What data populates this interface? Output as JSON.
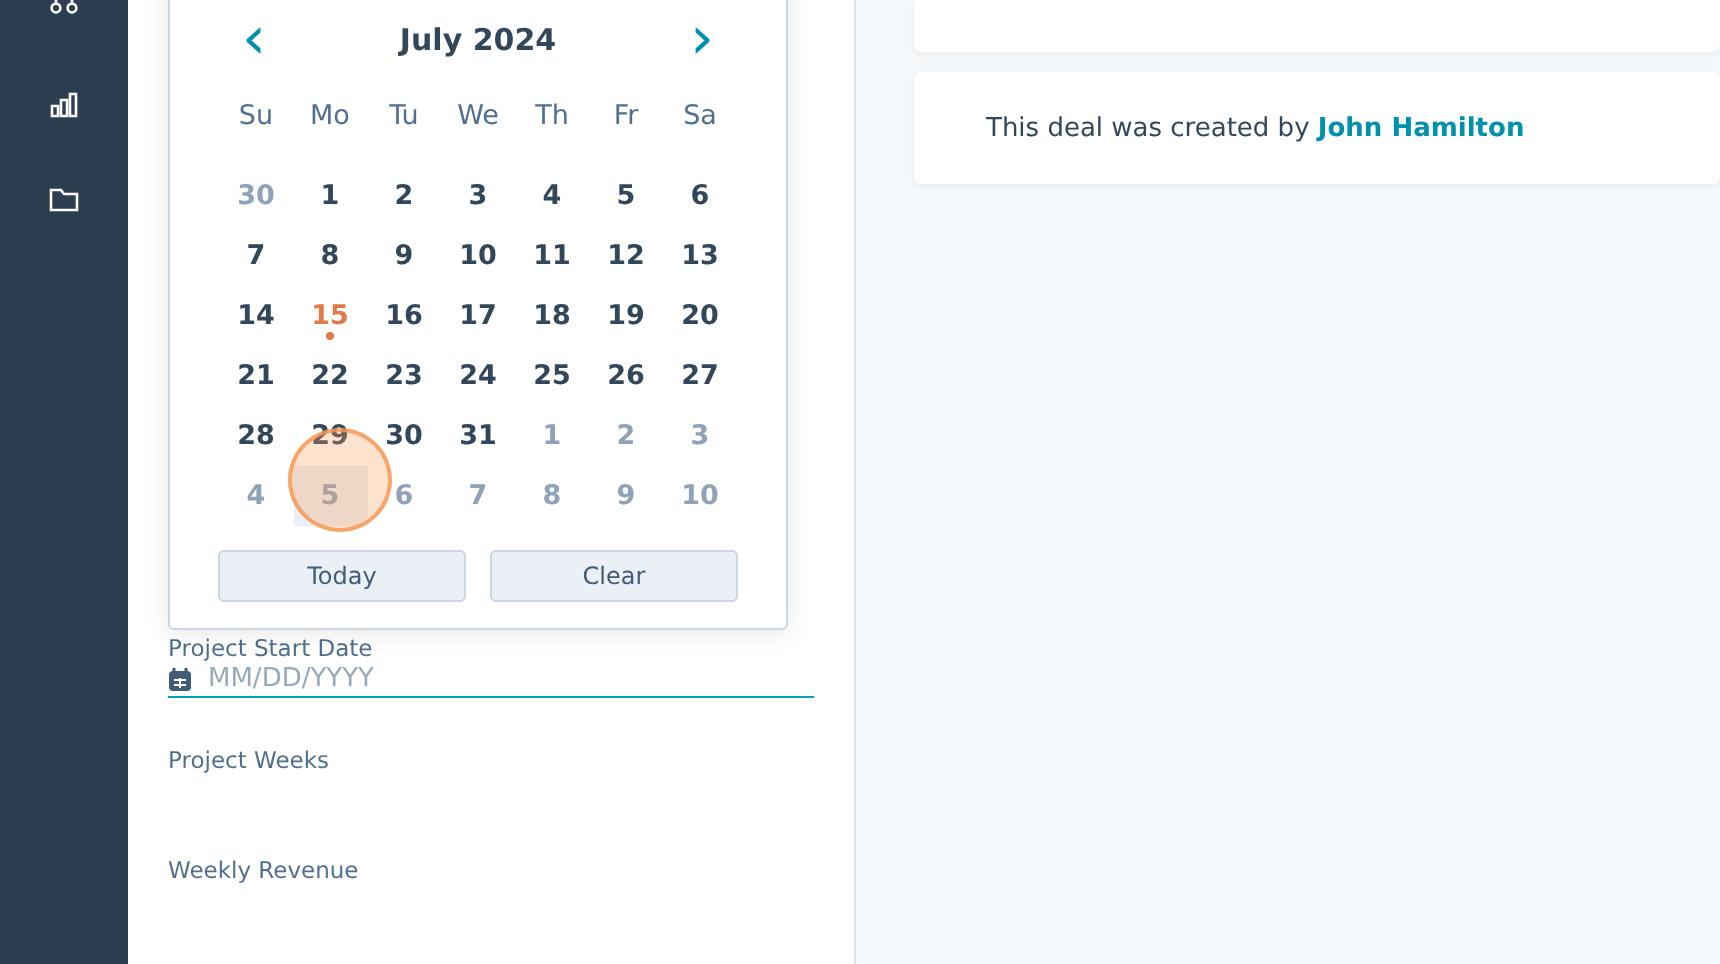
{
  "calendar": {
    "month": "July 2024",
    "prev": "‹",
    "next": "›",
    "weekdays": [
      "Su",
      "Mo",
      "Tu",
      "We",
      "Th",
      "Fr",
      "Sa"
    ],
    "weeks": [
      [
        {
          "day": "30",
          "outside": true,
          "today": false,
          "hovered": false
        },
        {
          "day": "1",
          "outside": false,
          "today": false,
          "hovered": false
        },
        {
          "day": "2",
          "outside": false,
          "today": false,
          "hovered": false
        },
        {
          "day": "3",
          "outside": false,
          "today": false,
          "hovered": false
        },
        {
          "day": "4",
          "outside": false,
          "today": false,
          "hovered": false
        },
        {
          "day": "5",
          "outside": false,
          "today": false,
          "hovered": false
        },
        {
          "day": "6",
          "outside": false,
          "today": false,
          "hovered": false
        }
      ],
      [
        {
          "day": "7",
          "outside": false,
          "today": false,
          "hovered": false
        },
        {
          "day": "8",
          "outside": false,
          "today": false,
          "hovered": false
        },
        {
          "day": "9",
          "outside": false,
          "today": false,
          "hovered": false
        },
        {
          "day": "10",
          "outside": false,
          "today": false,
          "hovered": false
        },
        {
          "day": "11",
          "outside": false,
          "today": false,
          "hovered": false
        },
        {
          "day": "12",
          "outside": false,
          "today": false,
          "hovered": false
        },
        {
          "day": "13",
          "outside": false,
          "today": false,
          "hovered": false
        }
      ],
      [
        {
          "day": "14",
          "outside": false,
          "today": false,
          "hovered": false
        },
        {
          "day": "15",
          "outside": false,
          "today": true,
          "hovered": false
        },
        {
          "day": "16",
          "outside": false,
          "today": false,
          "hovered": false
        },
        {
          "day": "17",
          "outside": false,
          "today": false,
          "hovered": false
        },
        {
          "day": "18",
          "outside": false,
          "today": false,
          "hovered": false
        },
        {
          "day": "19",
          "outside": false,
          "today": false,
          "hovered": false
        },
        {
          "day": "20",
          "outside": false,
          "today": false,
          "hovered": false
        }
      ],
      [
        {
          "day": "21",
          "outside": false,
          "today": false,
          "hovered": false
        },
        {
          "day": "22",
          "outside": false,
          "today": false,
          "hovered": false
        },
        {
          "day": "23",
          "outside": false,
          "today": false,
          "hovered": false
        },
        {
          "day": "24",
          "outside": false,
          "today": false,
          "hovered": false
        },
        {
          "day": "25",
          "outside": false,
          "today": false,
          "hovered": false
        },
        {
          "day": "26",
          "outside": false,
          "today": false,
          "hovered": false
        },
        {
          "day": "27",
          "outside": false,
          "today": false,
          "hovered": false
        }
      ],
      [
        {
          "day": "28",
          "outside": false,
          "today": false,
          "hovered": false
        },
        {
          "day": "29",
          "outside": false,
          "today": false,
          "hovered": false
        },
        {
          "day": "30",
          "outside": false,
          "today": false,
          "hovered": false
        },
        {
          "day": "31",
          "outside": false,
          "today": false,
          "hovered": false
        },
        {
          "day": "1",
          "outside": true,
          "today": false,
          "hovered": false
        },
        {
          "day": "2",
          "outside": true,
          "today": false,
          "hovered": false
        },
        {
          "day": "3",
          "outside": true,
          "today": false,
          "hovered": false
        }
      ],
      [
        {
          "day": "4",
          "outside": true,
          "today": false,
          "hovered": false
        },
        {
          "day": "5",
          "outside": true,
          "today": false,
          "hovered": true
        },
        {
          "day": "6",
          "outside": true,
          "today": false,
          "hovered": false
        },
        {
          "day": "7",
          "outside": true,
          "today": false,
          "hovered": false
        },
        {
          "day": "8",
          "outside": true,
          "today": false,
          "hovered": false
        },
        {
          "day": "9",
          "outside": true,
          "today": false,
          "hovered": false
        },
        {
          "day": "10",
          "outside": true,
          "today": false,
          "hovered": false
        }
      ]
    ],
    "buttons": [
      "Today",
      "Clear"
    ]
  },
  "fields": [
    {
      "label": "Project Start Date",
      "placeholder": "MM/DD/YYYY",
      "kind": "date",
      "focused": true
    },
    {
      "label": "Project Weeks",
      "kind": "text"
    },
    {
      "label": "Weekly Revenue",
      "kind": "text"
    }
  ],
  "activity": [
    {
      "text": "This deal was created by ",
      "author": "John Hamilton"
    }
  ]
}
